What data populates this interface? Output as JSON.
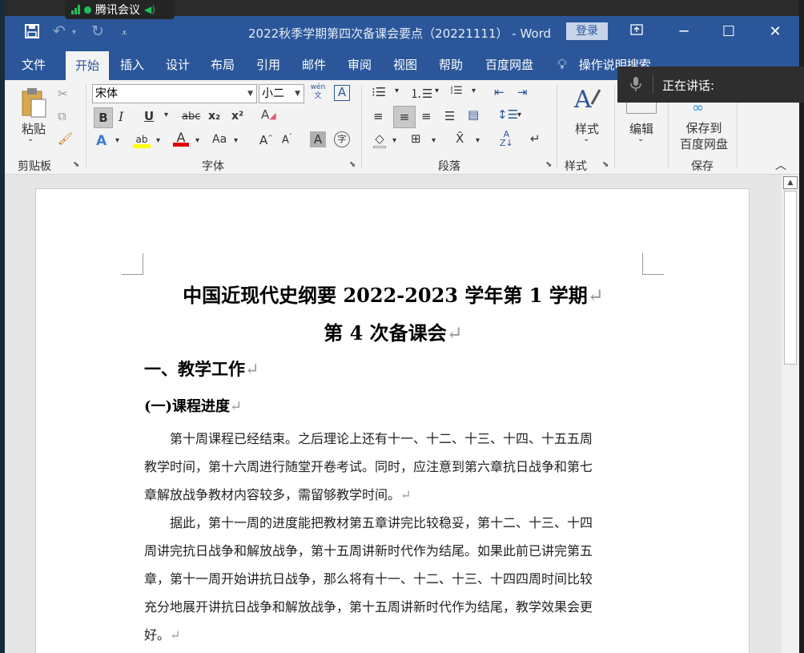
{
  "tencent": {
    "label": "腾讯会议"
  },
  "titlebar": {
    "title": "2022秋季学期第四次备课会要点（20221111） - Word",
    "login": "登录"
  },
  "tabs": [
    "文件",
    "开始",
    "插入",
    "设计",
    "布局",
    "引用",
    "邮件",
    "审阅",
    "视图",
    "帮助",
    "百度网盘"
  ],
  "active_tab": "开始",
  "tell_me": "操作说明搜索",
  "meeting": {
    "speaking": "正在讲话:"
  },
  "ribbon": {
    "clipboard": {
      "paste": "粘贴",
      "label": "剪贴板"
    },
    "font": {
      "name": "宋体",
      "size": "小二",
      "label": "字体",
      "bold": "B",
      "italic": "I",
      "underline": "U",
      "strike": "abc",
      "sub": "x₂",
      "sup": "x²",
      "grow": "A",
      "shrink": "A",
      "case": "Aa",
      "phonetic": "wén文",
      "border": "A"
    },
    "paragraph": {
      "label": "段落"
    },
    "styles": {
      "button": "样式",
      "label": "样式"
    },
    "editing": {
      "button": "编辑"
    },
    "save": {
      "button_line1": "保存到",
      "button_line2": "百度网盘",
      "label": "保存"
    }
  },
  "document": {
    "title_line1": "中国近现代史纲要 2022-2023 学年第 1 学期",
    "title_line2": "第 4 次备课会",
    "heading1": "一、教学工作",
    "heading2": "(一)课程进度",
    "para1": [
      "　　第十周课程已经结束。之后理论上还有十一、十二、十三、十四、十五五周",
      "教学时间，第十六周进行随堂开卷考试。同时，应注意到第六章抗日战争和第七",
      "章解放战争教材内容较多，需留够教学时间。"
    ],
    "para2": [
      "　　据此，第十一周的进度能把教材第五章讲完比较稳妥，第十二、十三、十四",
      "周讲完抗日战争和解放战争，第十五周讲新时代作为结尾。如果此前已讲完第五",
      "章，第十一周开始讲抗日战争，那么将有十一、十二、十三、十四四周时间比较",
      "充分地展开讲抗日战争和解放战争，第十五周讲新时代作为结尾，教学效果会更",
      "好。"
    ],
    "para_mark": "↵"
  }
}
